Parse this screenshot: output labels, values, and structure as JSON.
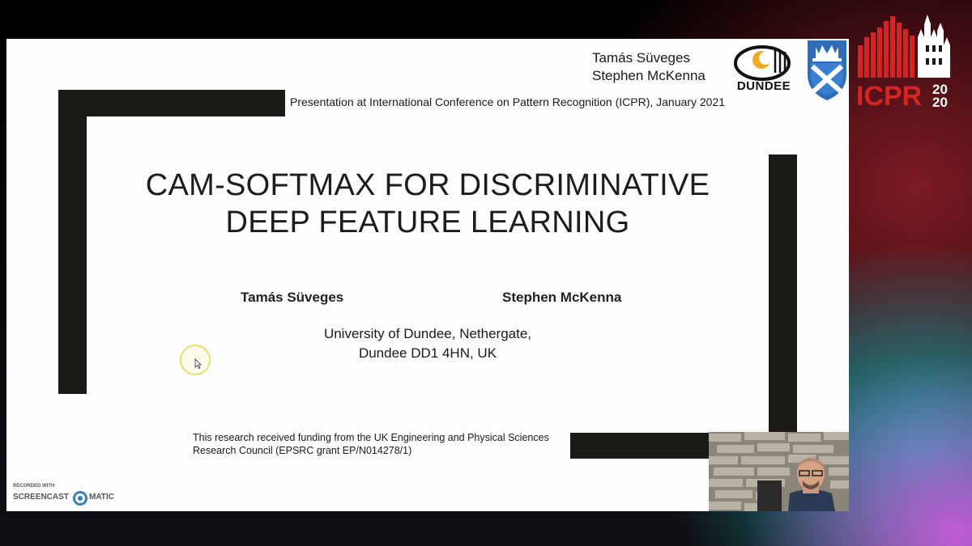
{
  "slide": {
    "header_authors": [
      "Tamás Süveges",
      "Stephen McKenna"
    ],
    "conference": "Presentation at International Conference on Pattern Recognition (ICPR), January 2021",
    "title_line1": "CAM-SOFTMAX FOR DISCRIMINATIVE",
    "title_line2": "DEEP FEATURE LEARNING",
    "author1": "Tamás Süveges",
    "author2": "Stephen McKenna",
    "affiliation_line1": "University of Dundee, Nethergate,",
    "affiliation_line2": "Dundee DD1 4HN, UK",
    "funding_line1": "This research received funding from the UK Engineering and Physical Sciences",
    "funding_line2": "Research Council (EPSRC grant EP/N014278/1)"
  },
  "logos": {
    "dundee_text": "DUNDEE",
    "icpr_text": "ICPR",
    "icpr_year_top": "20",
    "icpr_year_bottom": "20"
  },
  "watermark": {
    "small_text": "RECORDED WITH",
    "brand_left": "SCREENCAST",
    "brand_right": "MATIC"
  },
  "colors": {
    "slide_background": "#fdfdfd",
    "bar_color": "#1b1b15",
    "icpr_red": "#d42424",
    "cursor_highlight": "#e9dc6a"
  }
}
